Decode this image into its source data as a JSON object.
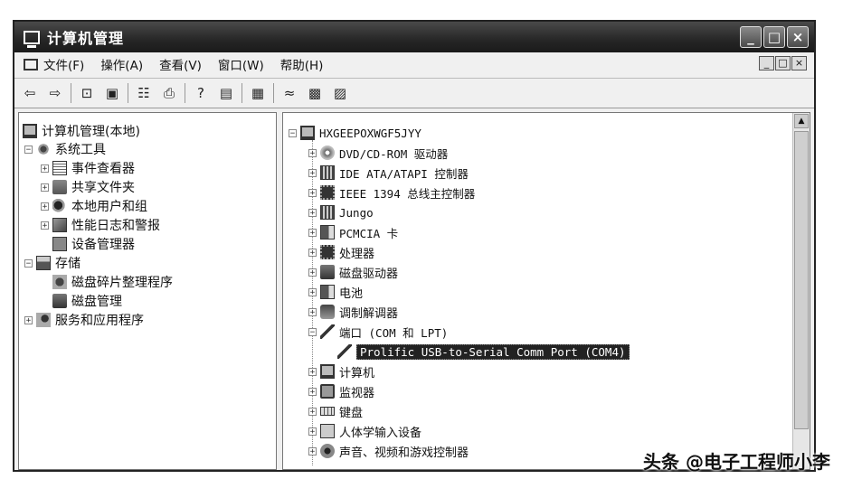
{
  "window": {
    "title": "计算机管理"
  },
  "titlebar_buttons": [
    "_",
    "□",
    "×"
  ],
  "menu": {
    "items": [
      "文件(F)",
      "操作(A)",
      "查看(V)",
      "窗口(W)",
      "帮助(H)"
    ],
    "mdi_buttons": [
      "_",
      "□",
      "×"
    ]
  },
  "toolbar": {
    "icons": [
      "back-icon",
      "forward-icon",
      "up-folder-icon",
      "show-tree-icon",
      "properties-icon",
      "print-icon",
      "help-icon",
      "console-icon",
      "scan-hardware-icon",
      "uninstall-icon",
      "disable-icon",
      "update-driver-icon"
    ],
    "glyphs": [
      "⇦",
      "⇨",
      "⊡",
      "▣",
      "☷",
      "⎙",
      "?",
      "▤",
      "▦",
      "≈",
      "▩",
      "▨"
    ]
  },
  "left_tree": [
    {
      "label": "计算机管理(本地)",
      "icon": "computer-icon",
      "expander": ""
    },
    {
      "label": "系统工具",
      "icon": "tools-icon",
      "expander": "−"
    },
    {
      "label": "事件查看器",
      "icon": "event-viewer-icon",
      "expander": "+"
    },
    {
      "label": "共享文件夹",
      "icon": "shared-folder-icon",
      "expander": "+"
    },
    {
      "label": "本地用户和组",
      "icon": "users-icon",
      "expander": "+"
    },
    {
      "label": "性能日志和警报",
      "icon": "performance-icon",
      "expander": "+"
    },
    {
      "label": "设备管理器",
      "icon": "device-manager-icon",
      "expander": ""
    },
    {
      "label": "存储",
      "icon": "storage-icon",
      "expander": "−"
    },
    {
      "label": "磁盘碎片整理程序",
      "icon": "defrag-icon",
      "expander": ""
    },
    {
      "label": "磁盘管理",
      "icon": "disk-management-icon",
      "expander": ""
    },
    {
      "label": "服务和应用程序",
      "icon": "services-icon",
      "expander": "+"
    }
  ],
  "right_tree": [
    {
      "label": "HXGEEPOXWGF5JYY",
      "icon": "computer-icon",
      "expander": "−"
    },
    {
      "label": "DVD/CD-ROM 驱动器",
      "icon": "dvd-icon",
      "expander": "+"
    },
    {
      "label": "IDE ATA/ATAPI 控制器",
      "icon": "ide-controller-icon",
      "expander": "+"
    },
    {
      "label": "IEEE 1394 总线主控制器",
      "icon": "ieee1394-icon",
      "expander": "+"
    },
    {
      "label": "Jungo",
      "icon": "jungo-icon",
      "expander": "+"
    },
    {
      "label": "PCMCIA 卡",
      "icon": "pcmcia-icon",
      "expander": "+"
    },
    {
      "label": "处理器",
      "icon": "processor-icon",
      "expander": "+"
    },
    {
      "label": "磁盘驱动器",
      "icon": "disk-drive-icon",
      "expander": "+"
    },
    {
      "label": "电池",
      "icon": "battery-icon",
      "expander": "+"
    },
    {
      "label": "调制解调器",
      "icon": "modem-icon",
      "expander": "+"
    },
    {
      "label": "端口 (COM 和 LPT)",
      "icon": "port-icon",
      "expander": "−"
    },
    {
      "label": "Prolific USB-to-Serial Comm Port (COM4)",
      "icon": "port-icon",
      "expander": ""
    },
    {
      "label": "计算机",
      "icon": "computer-icon",
      "expander": "+"
    },
    {
      "label": "监视器",
      "icon": "monitor-icon",
      "expander": "+"
    },
    {
      "label": "键盘",
      "icon": "keyboard-icon",
      "expander": "+"
    },
    {
      "label": "人体学输入设备",
      "icon": "hid-icon",
      "expander": "+"
    },
    {
      "label": "声音、视频和游戏控制器",
      "icon": "audio-icon",
      "expander": "+"
    }
  ],
  "selected_item": "Prolific USB-to-Serial Comm Port (COM4)",
  "watermark": "头条 @电子工程师小李"
}
